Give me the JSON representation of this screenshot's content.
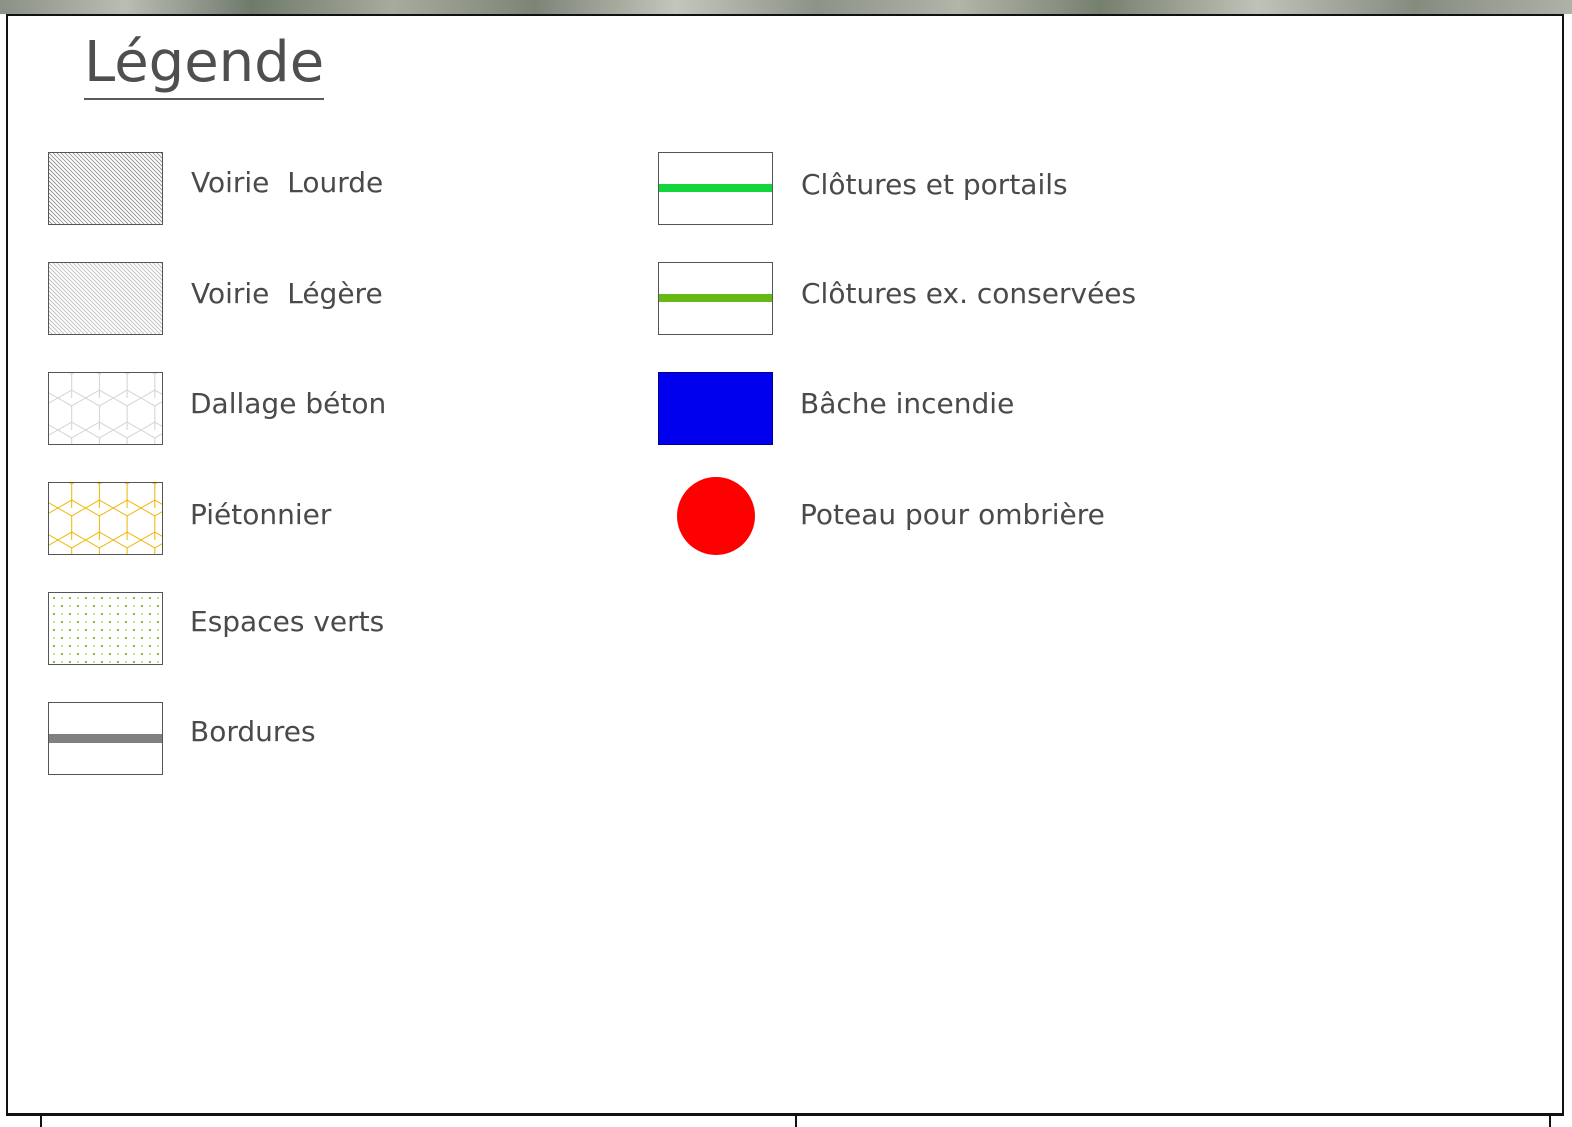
{
  "legend": {
    "title": "Légende",
    "left_column": [
      {
        "label": "Voirie  Lourde",
        "icon": "dense-hatch-icon"
      },
      {
        "label": "Voirie  Légère",
        "icon": "light-hatch-icon"
      },
      {
        "label": "Dallage béton",
        "icon": "grey-hexagon-pattern-icon"
      },
      {
        "label": "Piétonnier",
        "icon": "yellow-hexagon-pattern-icon"
      },
      {
        "label": "Espaces verts",
        "icon": "green-dot-pattern-icon"
      },
      {
        "label": "Bordures",
        "icon": "grey-line-icon"
      }
    ],
    "right_column": [
      {
        "label": "Clôtures et portails",
        "icon": "bright-green-line-icon"
      },
      {
        "label": "Clôtures ex. conservées",
        "icon": "olive-green-line-icon"
      },
      {
        "label": "Bâche incendie",
        "icon": "blue-rectangle-icon"
      },
      {
        "label": "Poteau pour ombrière",
        "icon": "red-circle-icon"
      }
    ]
  },
  "colors": {
    "text": "#4a4a4a",
    "frame": "#111111",
    "hatch_dense": "#8a8a8a",
    "hatch_light": "#b8b8b8",
    "hexagon_grey": "#d2d2d2",
    "hexagon_yellow": "#f0b400",
    "green_dots": "#66c21a",
    "border_grey": "#808080",
    "fence_new": "#12d63c",
    "fence_existing": "#66b814",
    "fire_tank": "#0000ee",
    "pole": "#ff0000"
  }
}
